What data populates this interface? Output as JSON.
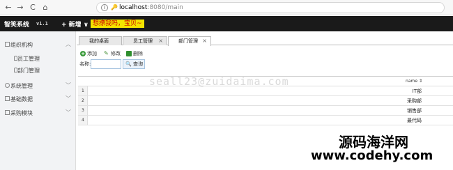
{
  "browser": {
    "back_icon": "←",
    "forward_icon": "→",
    "reload_icon": "C",
    "home_icon": "⌂",
    "info_icon": "i",
    "key_icon": "🔑",
    "url_host": "localhost",
    "url_path": ":8080/main"
  },
  "header": {
    "brand": "智笑系统",
    "version": "v1.1",
    "new_button": "+ 新增 ∨",
    "banner": "想撩我吗，宝贝~"
  },
  "sidebar": {
    "items": [
      {
        "label": "组织机构",
        "chevron": "︿",
        "children": [
          "员工管理",
          "部门管理"
        ]
      },
      {
        "label": "系统管理",
        "chevron": "﹀"
      },
      {
        "label": "基础数据",
        "chevron": "﹀"
      },
      {
        "label": "采购模块",
        "chevron": "﹀"
      }
    ]
  },
  "tabs": [
    {
      "label": "我的桌面",
      "close": ""
    },
    {
      "label": "员工管理",
      "close": "×"
    },
    {
      "label": "部门管理",
      "close": "×"
    }
  ],
  "toolbar": {
    "add": "添加",
    "edit": "修改",
    "delete": "删除"
  },
  "search": {
    "label": "名称:",
    "value": "",
    "button": "查询"
  },
  "grid": {
    "column": "name ⇕",
    "rows": [
      {
        "num": "1",
        "name": "IT部"
      },
      {
        "num": "2",
        "name": "采购部"
      },
      {
        "num": "3",
        "name": "销售部"
      },
      {
        "num": "4",
        "name": "最代码"
      }
    ]
  },
  "overlays": {
    "watermark": "seall23@zuidaima.com",
    "site_name": "源码海洋网",
    "site_url": "www.codehy.com"
  }
}
